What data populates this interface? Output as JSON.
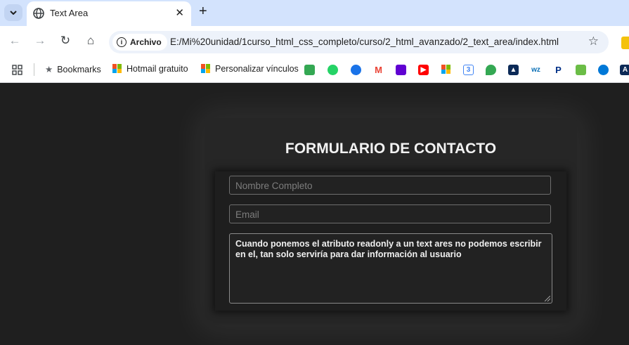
{
  "browser": {
    "tab": {
      "title": "Text Area",
      "close": "✕"
    },
    "new_tab": "+",
    "toolbar": {
      "back": "←",
      "forward": "→",
      "reload": "↻",
      "home": "⌂",
      "chip_label": "Archivo",
      "url": "E:/Mi%20unidad/1curso_html_css_completo/curso/2_html_avanzado/2_text_area/index.html",
      "star": "☆"
    },
    "bookmarks": {
      "apps_icon": "apps-grid",
      "items": [
        "Bookmarks",
        "Hotmail gratuito",
        "Personalizar vínculos"
      ],
      "favicons": [
        "meet",
        "whatsapp",
        "messages",
        "gmail",
        "mail",
        "youtube",
        "microsoft",
        "calendar",
        "maps",
        "atlassian",
        "wz",
        "paypal",
        "deepl",
        "edge",
        "account"
      ]
    }
  },
  "colors": {
    "tabbar": "#d3e3fd",
    "page": "#1f1f1f",
    "card": "#262626"
  },
  "form": {
    "title": "FORMULARIO DE CONTACTO",
    "name_placeholder": "Nombre Completo",
    "email_placeholder": "Email",
    "textarea_value": "Cuando ponemos el atributo readonly a un text ares no podemos escribir en el, tan solo serviría para dar información al usuario"
  }
}
